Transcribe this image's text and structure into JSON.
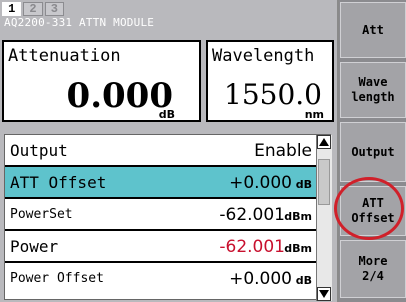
{
  "tabs": [
    "1",
    "2",
    "3"
  ],
  "module_title": "AQ2200-331 ATTN MODULE",
  "attenuation": {
    "label": "Attenuation",
    "value": "0.000",
    "unit": "dB"
  },
  "wavelength": {
    "label": "Wavelength",
    "value": "1550.0",
    "unit": "nm"
  },
  "list": [
    {
      "label": "Output",
      "value": "Enable",
      "unit": ""
    },
    {
      "label": "ATT Offset",
      "value": "+0.000",
      "unit": "dB"
    },
    {
      "label": "PowerSet",
      "value": "-62.001",
      "unit": "dBm"
    },
    {
      "label": "Power",
      "value": "-62.001",
      "unit": "dBm"
    },
    {
      "label": "Power Offset",
      "value": "+0.000",
      "unit": "dB"
    }
  ],
  "softkeys": {
    "att": "Att",
    "wavelength": "Wave\nlength",
    "output": "Output",
    "att_offset": "ATT\nOffset",
    "more": "More\n2/4"
  },
  "colors": {
    "selected_row": "#5ec3cc",
    "power_value": "#c8102e",
    "highlight_circle": "#d0202a"
  }
}
